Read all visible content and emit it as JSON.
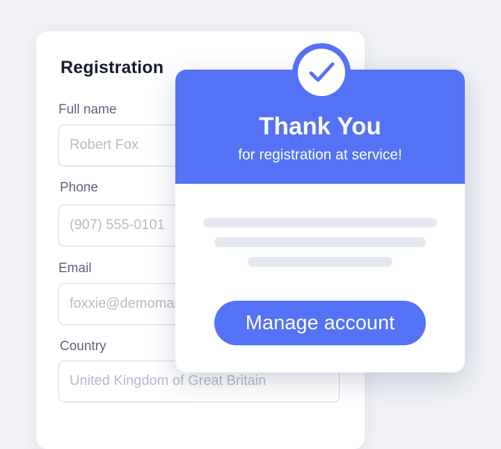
{
  "registration": {
    "title": "Registration",
    "fields": [
      {
        "label": "Full name",
        "value": "Robert Fox"
      },
      {
        "label": "Phone",
        "value": "(907) 555-0101"
      },
      {
        "label": "Email",
        "value": "foxxie@demomail.com"
      },
      {
        "label": "Country",
        "value": "United Kingdom of Great Britain"
      }
    ]
  },
  "thank_you": {
    "title": "Thank You",
    "subtitle": "for registration at service!",
    "icon": "check-icon",
    "button_label": "Manage account"
  },
  "colors": {
    "accent": "#5472f6",
    "background": "#f0f2f7",
    "placeholder": "#b3bcca",
    "skeleton": "#e4e8f0"
  }
}
